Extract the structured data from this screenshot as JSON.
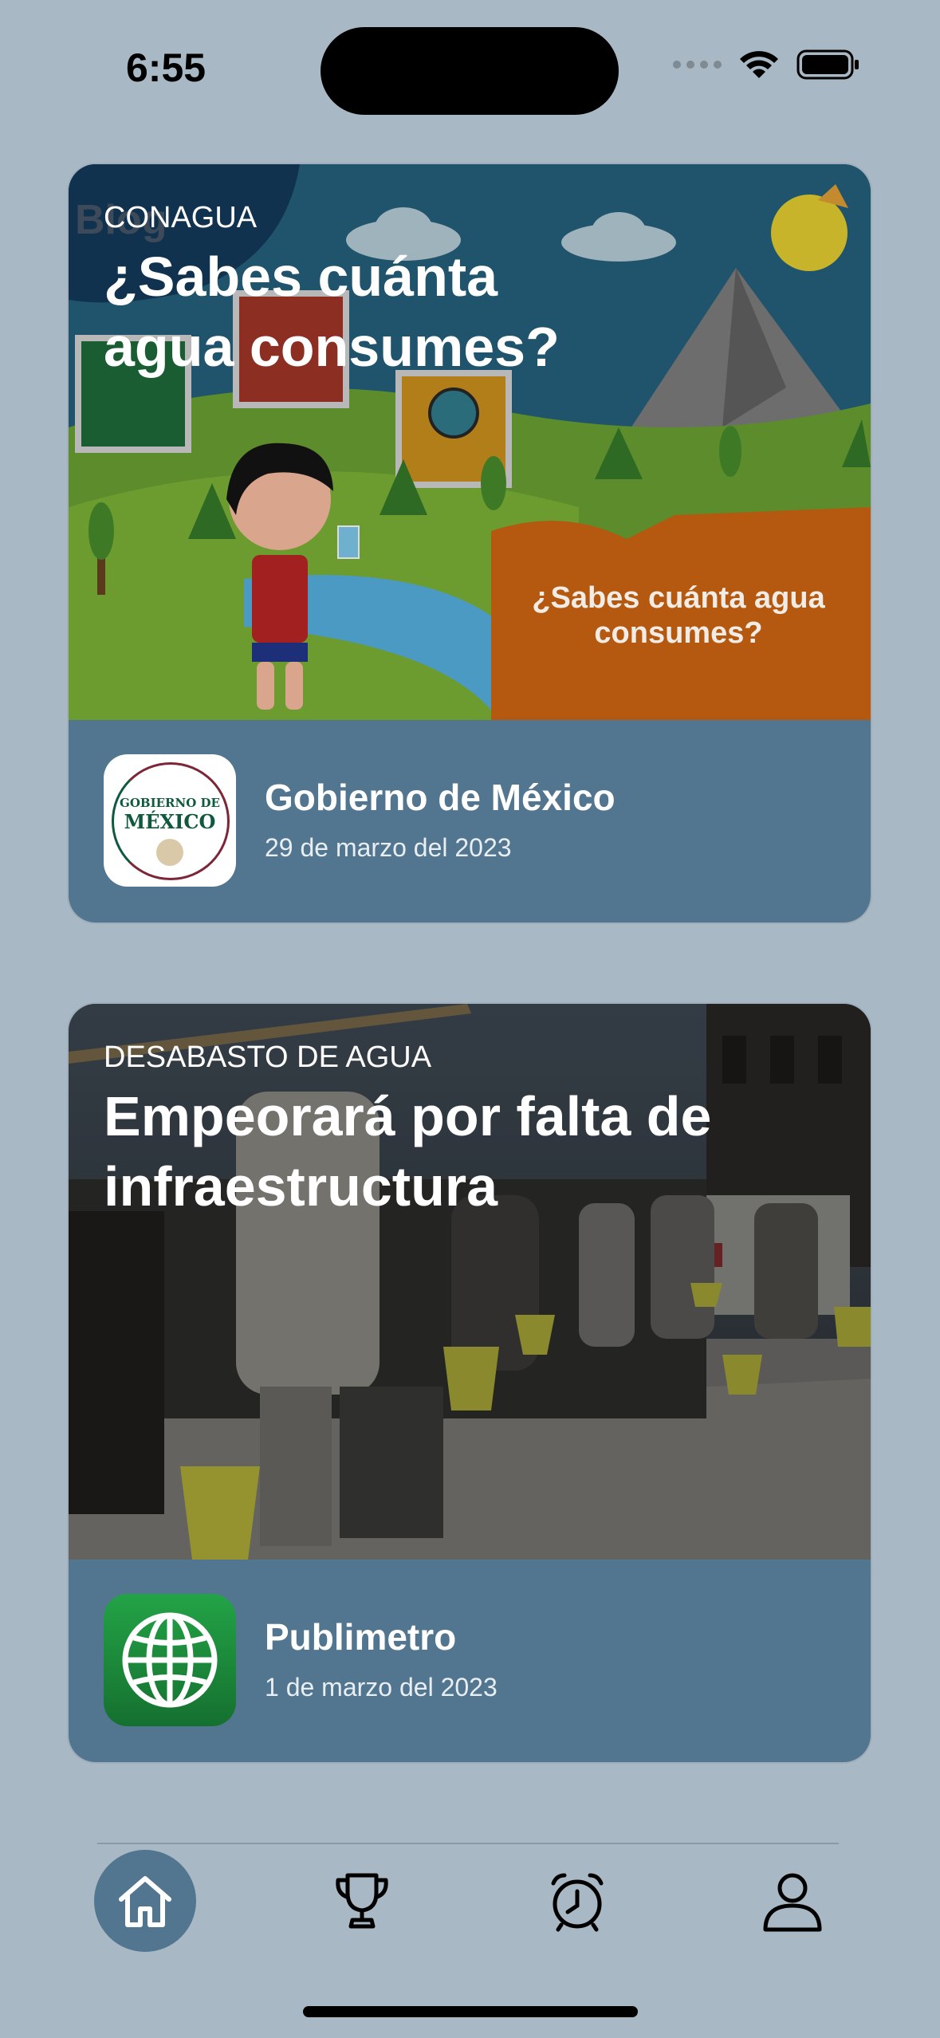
{
  "status_bar": {
    "time": "6:55"
  },
  "cards": [
    {
      "kicker": "CONAGUA",
      "headline_line1": "¿Sabes cuánta",
      "headline_line2": "agua consumes?",
      "image_caption_line1": "¿Sabes cuánta agua",
      "image_caption_line2": "consumes?",
      "image_corner_text": "Blog",
      "source_name": "Gobierno de México",
      "source_date": "29 de marzo del 2023",
      "logo_line1": "GOBIERNO DE",
      "logo_line2": "MÉXICO"
    },
    {
      "kicker": "DESABASTO DE AGUA",
      "headline_line1": "Empeorará por falta de",
      "headline_line2": "infraestructura",
      "source_name": "Publimetro",
      "source_date": "1 de marzo del 2023"
    }
  ],
  "tab_bar": {
    "tabs": [
      {
        "icon": "home-icon",
        "active": true
      },
      {
        "icon": "trophy-icon",
        "active": false
      },
      {
        "icon": "alarm-clock-icon",
        "active": false
      },
      {
        "icon": "person-icon",
        "active": false
      }
    ]
  },
  "colors": {
    "background": "#a8b8c4",
    "card_footer": "#52768f",
    "active_tab": "#52768f",
    "globe_green": "#1f8a3d"
  }
}
